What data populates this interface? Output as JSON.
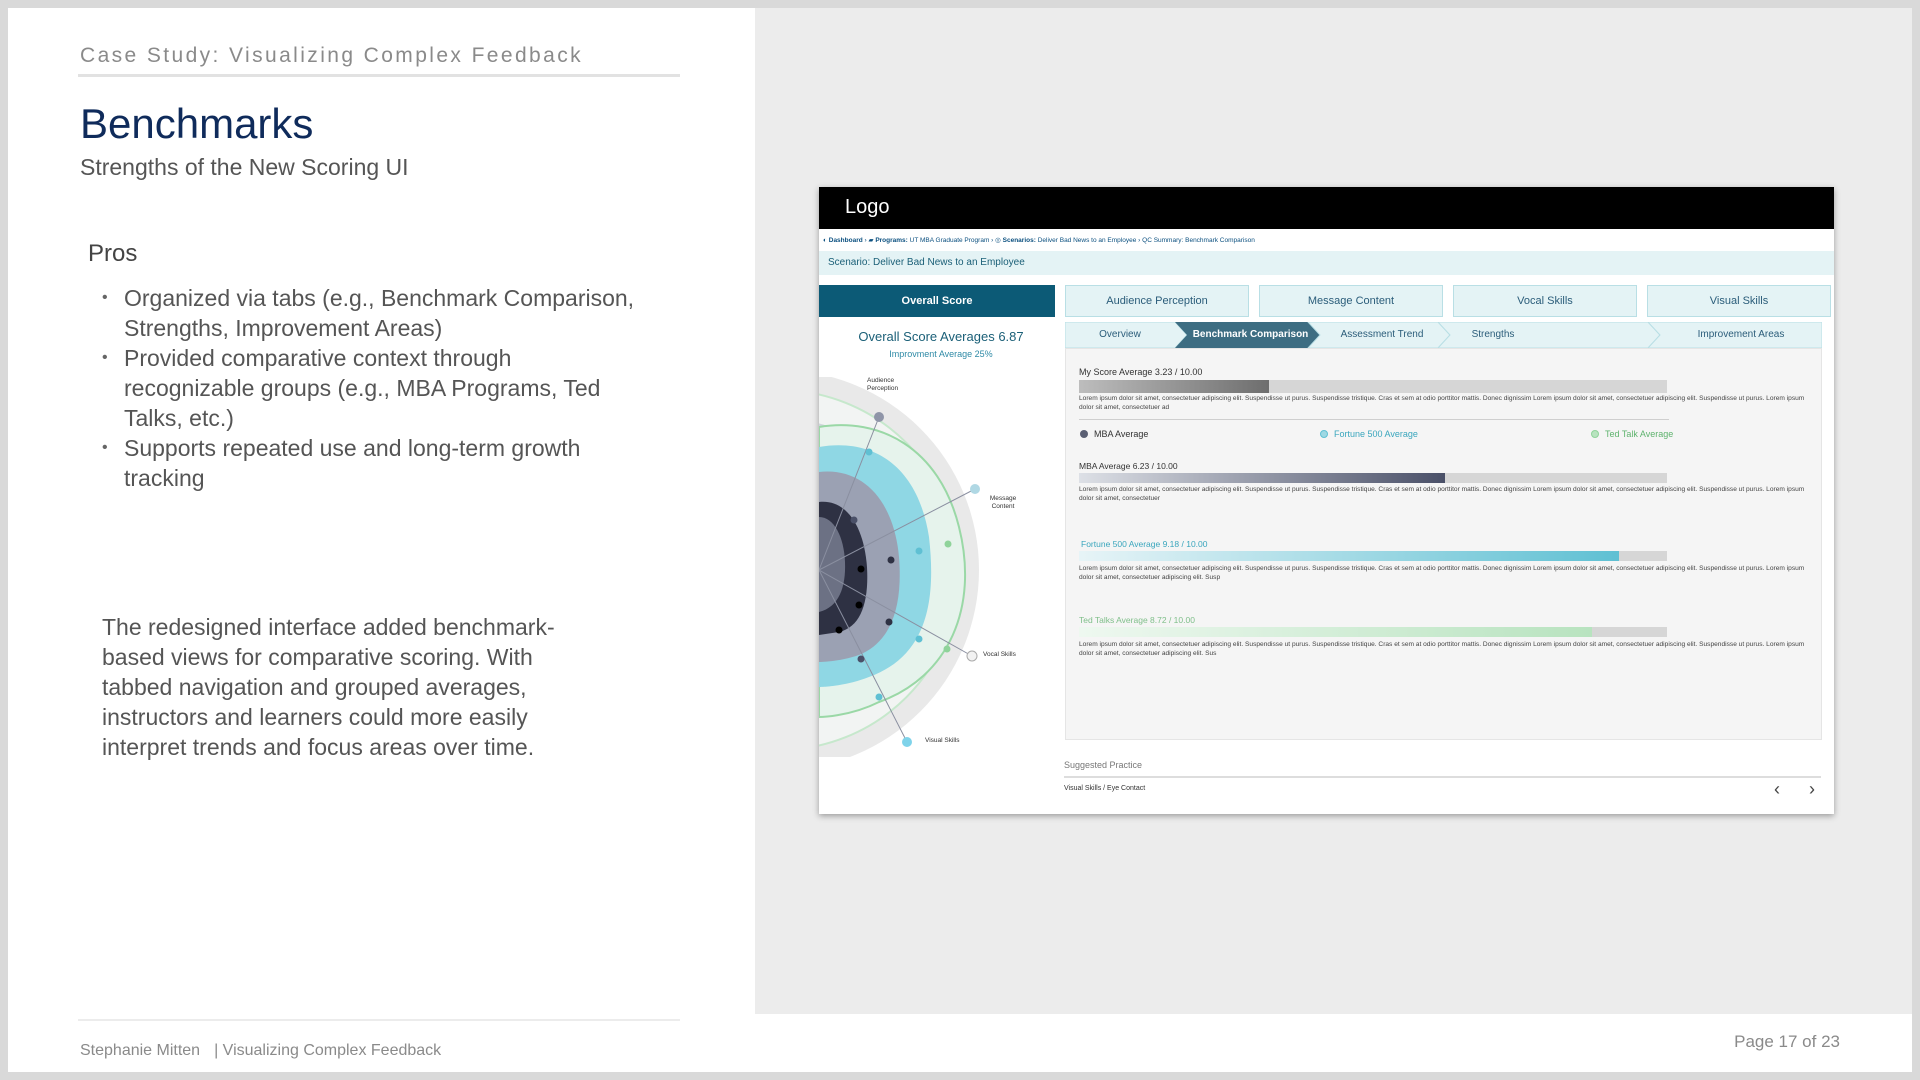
{
  "slide": {
    "eyebrow": "Case Study: Visualizing Complex Feedback",
    "title": "Benchmarks",
    "subtitle": "Strengths of the New Scoring UI",
    "pros_heading": "Pros",
    "bullets": [
      "Organized via tabs (e.g., Benchmark Comparison, Strengths, Improvement Areas)",
      "Provided comparative context through recognizable groups (e.g., MBA Programs, Ted Talks, etc.)",
      "Supports repeated use and long-term growth tracking"
    ],
    "summary": "The redesigned interface added benchmark-based views for comparative scoring. With tabbed navigation and grouped averages, instructors and learners could more easily interpret trends and focus areas over time.",
    "footer_author": "Stephanie Mitten",
    "footer_project": "| Visualizing Complex Feedback",
    "page": "Page 17 of 23"
  },
  "mock": {
    "logo": "Logo",
    "breadcrumb": {
      "dashboard": "Dashboard",
      "programs_label": "Programs:",
      "programs_value": "UT MBA Graduate Program",
      "scenarios_label": "Scenarios:",
      "scenarios_value": "Deliver Bad News to an Employee",
      "summary": "QC Summary: Benchmark Comparison"
    },
    "scenario": "Scenario:  Deliver Bad News to an Employee",
    "score_tabs": [
      "Overall Score",
      "Audience Perception",
      "Message Content",
      "Vocal Skills",
      "Visual Skills"
    ],
    "overall_title": "Overall Score Averages 6.87",
    "overall_sub": "Improvment Average 25%",
    "radar_labels": {
      "audience": "Audience Perception",
      "message": "Message Content",
      "vocal": "Vocal Skills",
      "visual": "Visual Skills"
    },
    "sub_tabs": [
      "Overview",
      "Benchmark Comparison",
      "Assessment Trend",
      "Strengths",
      "Improvement Areas"
    ],
    "bars": [
      {
        "label": "My Score Average  3.23 / 10.00",
        "value": 3.23,
        "max": 10,
        "lorem": "Lorem ipsum dolor sit amet, consectetuer adipiscing elit. Suspendisse ut purus. Suspendisse tristique. Cras et sem at odio porttitor mattis. Donec dignissim   Lorem ipsum dolor sit amet, consectetuer adipiscing elit. Suspendisse ut purus. Lorem ipsum dolor sit amet, consectetuer ad"
      },
      {
        "label": "MBA Average  6.23 / 10.00",
        "value": 6.23,
        "max": 10,
        "lorem": "Lorem ipsum dolor sit amet, consectetuer adipiscing elit. Suspendisse ut purus. Suspendisse tristique. Cras et sem at odio porttitor mattis. Donec dignissim   Lorem ipsum dolor sit amet, consectetuer adipiscing elit. Suspendisse ut purus. Lorem ipsum dolor sit amet, consectetuer"
      },
      {
        "label": "Fortune 500 Average 9.18 / 10.00",
        "value": 9.18,
        "max": 10,
        "lorem": "Lorem ipsum dolor sit amet, consectetuer adipiscing elit. Suspendisse ut purus. Suspendisse tristique. Cras et sem at odio porttitor mattis. Donec dignissim   Lorem ipsum dolor sit amet, consectetuer adipiscing elit. Suspendisse ut purus. Lorem ipsum dolor sit amet, consectetuer adipiscing elit. Susp"
      },
      {
        "label": "Ted Talks Average 8.72 / 10.00",
        "value": 8.72,
        "max": 10,
        "lorem": "Lorem ipsum dolor sit amet, consectetuer adipiscing elit. Suspendisse ut purus. Suspendisse tristique. Cras et sem at odio porttitor mattis. Donec dignissim   Lorem ipsum dolor sit amet, consectetuer adipiscing elit. Suspendisse ut purus. Lorem ipsum dolor sit amet, consectetuer adipiscing elit. Sus"
      }
    ],
    "legend": [
      {
        "label": "MBA Average",
        "color": "#5a5f73"
      },
      {
        "label": "Fortune 500 Average",
        "color": "#5fc0d3"
      },
      {
        "label": "Ted Talk Average",
        "color": "#8fd39a"
      }
    ],
    "suggested_label": "Suggested Practice",
    "suggested_item": "Visual Skills / Eye Contact",
    "colors": {
      "primary": "#0c5a76",
      "tab_bg": "#e4f3f5",
      "my_score": "#7a7a7a",
      "mba": "#4a5068",
      "fortune": "#5fc0d3",
      "ted": "#b8e3bf"
    }
  }
}
